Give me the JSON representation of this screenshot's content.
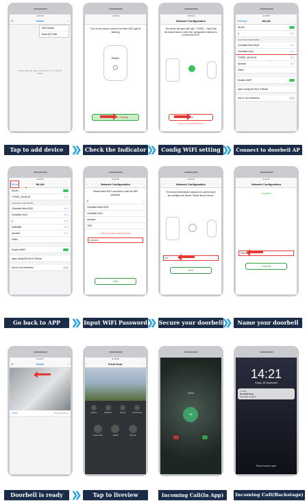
{
  "labels": {
    "r1": [
      "Tap to add device",
      "Check the Indicator",
      "Config WiFi setting",
      "Connect to doorbell AP"
    ],
    "r2": [
      "Go back to APP",
      "Input WiFi Password",
      "Secure your doorbell",
      "Name your doorbell"
    ],
    "r3": [
      "Doorbell is ready",
      "Tap to liveview",
      "Incoming Call(In App)",
      "Incoming Call(Backstage)"
    ]
  },
  "screens": {
    "s1": {
      "title": "ToSee",
      "menu": [
        "ADD Device",
        "Scan QR Code"
      ],
      "hint": "Please click the upper right corner \"+\" to add the device"
    },
    "s2": {
      "title": "Network Configuration",
      "instruction": "Turn on the device, check if the Red LED Light is flashing",
      "device": "Device",
      "button": "The Red Light is Flashing"
    },
    "s3": {
      "title": "Network Configuration",
      "instruction": "The device will open WiFi with \" TOSEE_ \" field Click the button below to enter the Configuration interface to connect the Wi-Fi.",
      "button": "Next",
      "link": "How to connect the device?"
    },
    "s4": {
      "back": "Settings",
      "title": "WLAN",
      "wlan": "WLAN",
      "choose": "CHOOSE A NETWORK...",
      "networks": [
        "ChinaNet-Wisn-RQD",
        "ChinaNet-YenC",
        "TOSEE_A5-e8-25",
        "Iproduct",
        "Other..."
      ],
      "current": "ji",
      "wapi": "Enable WAPI",
      "apps": "Apps Using WLAN & Cellular",
      "ask": "Ask to Join Networks"
    },
    "s5": {
      "back": "ToSee",
      "title": "WLAN",
      "wlan": "WLAN",
      "current": "TOSEE_A5-e8-25",
      "choose": "CHOOSE A NETWORK...",
      "networks": [
        "ChinaNet-Wisn-RQD",
        "ChinaNet-YenC",
        "ji",
        "tinstri888",
        "Iproduct",
        "Other..."
      ],
      "wapi": "Enable WAPI",
      "apps": "Apps Using WLAN & Cellular",
      "ask": "Ask to Join Networks"
    },
    "s6": {
      "title": "Network Configuration",
      "prompt": "Please select Wi-Fi connection, enter the WiFi password",
      "networks": [
        "ji",
        "ChinaNet-Wisn-RQD",
        "ChinaNet-YenC",
        "Iproduct",
        "YIBJ"
      ],
      "cannot": "Cannot find above Wi-Fi network",
      "password": "•••••••••••",
      "button": "Next"
    },
    "s7": {
      "title": "Network Configuration",
      "instruction": "The device administrator password is used to share and configure the device. Please keep it secure.",
      "password": "••••",
      "button": "Next"
    },
    "s8": {
      "title": "Network Configuration",
      "status": "Succeed",
      "name": "Porch",
      "button": "Complete"
    },
    "s9": {
      "title": "ToSee",
      "device": "Porch",
      "actions": "Playback  Delete"
    },
    "s10": {
      "title": "Front Door",
      "controls": [
        "Volume",
        "Playback",
        "Screen",
        "Full Screen",
        "Screenshot",
        "Speak",
        "Record"
      ]
    },
    "s11": {
      "name": "ToSee",
      "timer": "Tlk"
    },
    "s12": {
      "time": "14:21",
      "date": "Friday, 28 September",
      "app": "TOSEE",
      "notif_title": "Doorbell Ring",
      "notif_body": "You have a visitor",
      "hint": "Press home to open"
    }
  },
  "colors": {
    "label_bg": "#1b2c49",
    "chevron": "#2fa6e0",
    "accent_red": "#e53935",
    "toggle_on": "#36c45b"
  }
}
